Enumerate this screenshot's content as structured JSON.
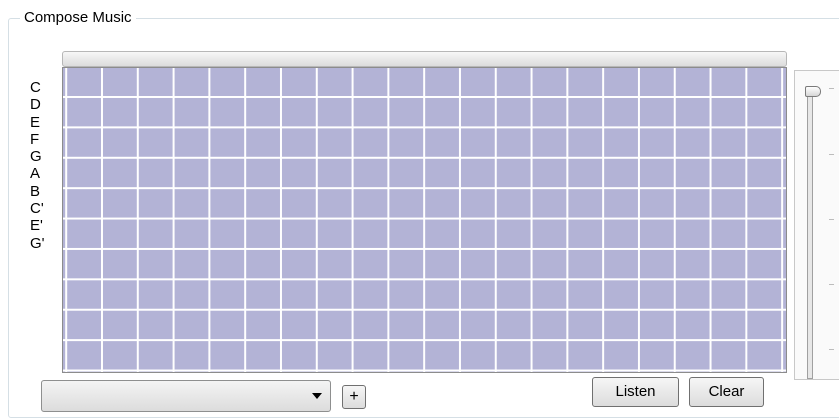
{
  "groupbox": {
    "title": "Compose Music"
  },
  "notes": [
    "C",
    "D",
    "E",
    "F",
    "G",
    "A",
    "B",
    "C'",
    "E'",
    "G'"
  ],
  "dropdown": {
    "selected": ""
  },
  "buttons": {
    "add": "+",
    "listen": "Listen",
    "clear": "Clear"
  },
  "colors": {
    "grid_cell": "#b3b3d6",
    "grid_line": "#ffffff"
  },
  "icons": {
    "dropdown": "chevron-down-icon"
  }
}
